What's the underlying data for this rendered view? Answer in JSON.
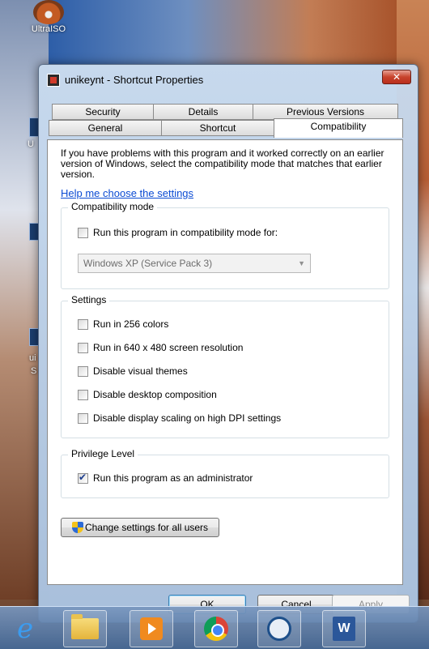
{
  "desktop": {
    "icons": [
      {
        "label": "UltraISO",
        "icon": "disc-icon"
      }
    ],
    "partial_labels": [
      "U",
      "ui",
      "S"
    ]
  },
  "window": {
    "title": "unikeynt - Shortcut Properties",
    "close_symbol": "✕",
    "tabs_row1": [
      "Security",
      "Details",
      "Previous Versions"
    ],
    "tabs_row2": [
      "General",
      "Shortcut",
      "Compatibility"
    ],
    "active_tab": "Compatibility",
    "intro_text": "If you have problems with this program and it worked correctly on an earlier version of Windows, select the compatibility mode that matches that earlier version.",
    "help_link": "Help me choose the settings",
    "compat_mode": {
      "label": "Compatibility mode",
      "checkbox_label": "Run this program in compatibility mode for:",
      "checked": false,
      "selected_os": "Windows XP (Service Pack 3)"
    },
    "settings": {
      "label": "Settings",
      "options": [
        {
          "label": "Run in 256 colors",
          "checked": false
        },
        {
          "label": "Run in 640 x 480 screen resolution",
          "checked": false
        },
        {
          "label": "Disable visual themes",
          "checked": false
        },
        {
          "label": "Disable desktop composition",
          "checked": false
        },
        {
          "label": "Disable display scaling on high DPI settings",
          "checked": false
        }
      ]
    },
    "privilege": {
      "label": "Privilege Level",
      "checkbox_label": "Run this program as an administrator",
      "checked": true
    },
    "change_all_label": "Change settings for all users",
    "buttons": {
      "ok": "OK",
      "cancel": "Cancel",
      "apply": "Apply"
    }
  },
  "taskbar": {
    "items": [
      "internet-explorer-icon",
      "file-explorer-icon",
      "media-player-icon",
      "chrome-icon",
      "sync-app-icon",
      "word-icon"
    ],
    "word_glyph": "W"
  },
  "colors": {
    "link": "#0b4bd3",
    "close_button": "#c8432c",
    "checkbox_mark": "#1f3f8f"
  }
}
